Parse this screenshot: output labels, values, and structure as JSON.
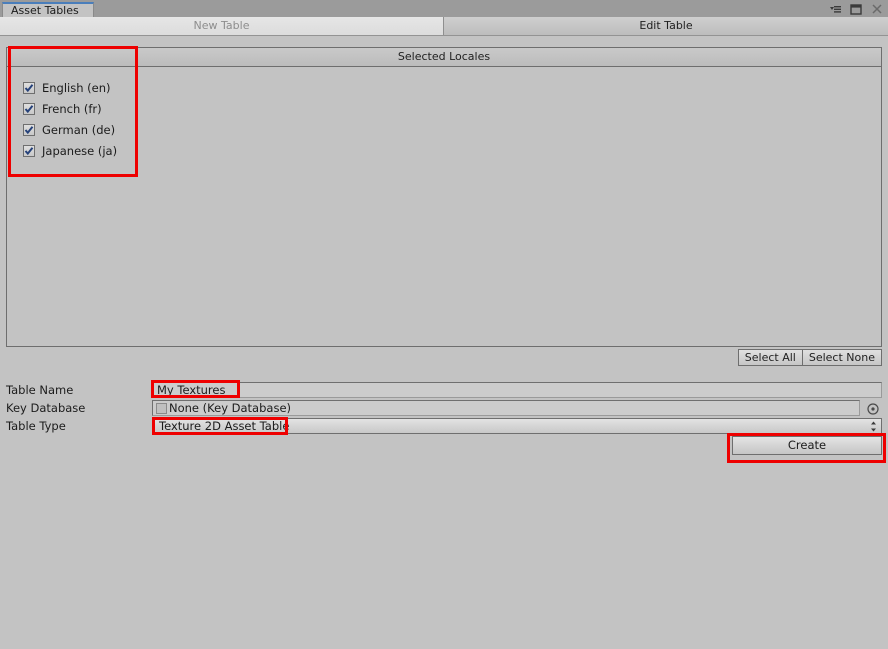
{
  "window": {
    "tab_label": "Asset Tables",
    "controls": [
      {
        "name": "window-menu-icon",
        "label": "▾≡"
      },
      {
        "name": "maximize-icon",
        "label": "□"
      },
      {
        "name": "close-icon",
        "label": "×"
      }
    ],
    "accent_color": "#4a7ebb"
  },
  "toolbar": {
    "tabs": [
      {
        "label": "New Table",
        "active": true
      },
      {
        "label": "Edit Table",
        "active": false
      }
    ]
  },
  "locale_panel": {
    "header": "Selected Locales",
    "locales": [
      {
        "label": "English (en)",
        "checked": true
      },
      {
        "label": "French (fr)",
        "checked": true
      },
      {
        "label": "German (de)",
        "checked": true
      },
      {
        "label": "Japanese (ja)",
        "checked": true
      }
    ],
    "select_all_label": "Select All",
    "select_none_label": "Select None"
  },
  "form": {
    "table_name": {
      "label": "Table Name",
      "value": "My Textures"
    },
    "key_database": {
      "label": "Key Database",
      "value": "None (Key Database)",
      "picker_icon": "object-picker-icon"
    },
    "table_type": {
      "label": "Table Type",
      "value": "Texture 2D Asset Table"
    },
    "create_label": "Create"
  },
  "annotations": {
    "color": "#ee0000",
    "boxes": [
      {
        "name": "annotation-locales",
        "target": "locale-list"
      },
      {
        "name": "annotation-table-name",
        "target": "table-name-field"
      },
      {
        "name": "annotation-table-type",
        "target": "table-type-dropdown"
      },
      {
        "name": "annotation-create",
        "target": "create-button"
      }
    ]
  }
}
